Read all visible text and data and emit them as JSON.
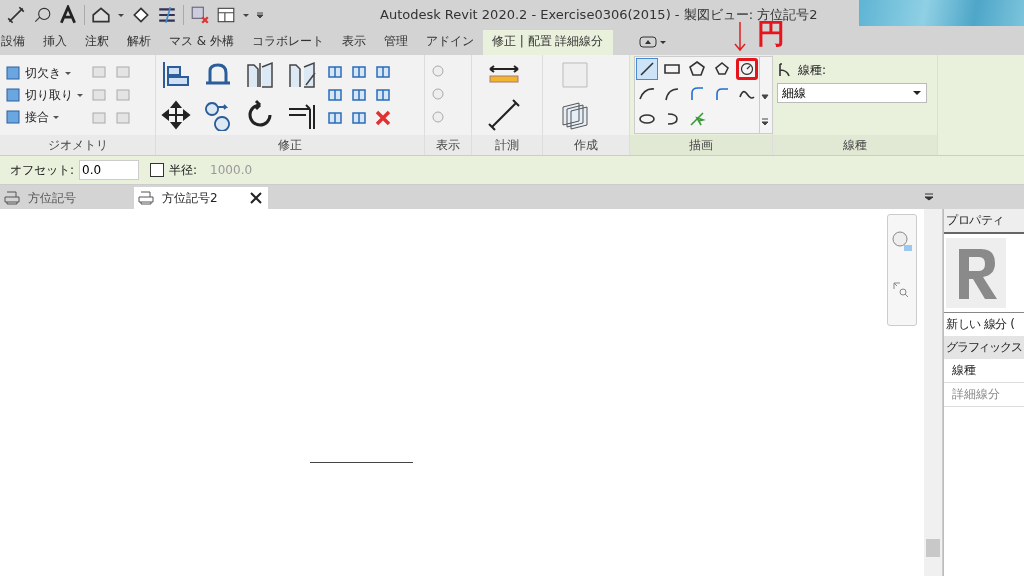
{
  "title_bar": {
    "title": "Autodesk Revit 2020.2 - Exercise0306(2015) - 製図ビュー: 方位記号2"
  },
  "ribbon_tabs": [
    {
      "label": "設備",
      "selected": false
    },
    {
      "label": "挿入",
      "selected": false
    },
    {
      "label": "注釈",
      "selected": false
    },
    {
      "label": "解析",
      "selected": false
    },
    {
      "label": "マス & 外構",
      "selected": false
    },
    {
      "label": "コラボレート",
      "selected": false
    },
    {
      "label": "表示",
      "selected": false
    },
    {
      "label": "管理",
      "selected": false
    },
    {
      "label": "アドイン",
      "selected": false
    },
    {
      "label": "修正 | 配置 詳細線分",
      "selected": true
    }
  ],
  "ribbon_panels": [
    {
      "kind": "geometry",
      "label": "ジオメトリ",
      "commands": [
        {
          "label": "切欠き"
        },
        {
          "label": "切り取り"
        },
        {
          "label": "接合"
        }
      ]
    },
    {
      "kind": "modify",
      "label": "修正"
    },
    {
      "kind": "view",
      "label": "表示"
    },
    {
      "kind": "measure",
      "label": "計測"
    },
    {
      "kind": "create",
      "label": "作成"
    },
    {
      "kind": "draw",
      "label": "描画",
      "tools": [
        {
          "kind": "line",
          "selected": true
        },
        {
          "kind": "rect",
          "selected": false
        },
        {
          "kind": "polygon",
          "selected": false
        },
        {
          "kind": "polygon2",
          "selected": false
        },
        {
          "kind": "circle",
          "selected": false,
          "annotated": true
        },
        {
          "kind": "arc3",
          "selected": false
        },
        {
          "kind": "arc",
          "selected": false
        },
        {
          "kind": "arc-tan",
          "selected": false
        },
        {
          "kind": "fillet",
          "selected": false
        },
        {
          "kind": "spline",
          "selected": false
        },
        {
          "kind": "ellipse",
          "selected": false
        },
        {
          "kind": "half",
          "selected": false
        },
        {
          "kind": "pick",
          "selected": false
        }
      ]
    },
    {
      "kind": "linestyle",
      "label": "線種",
      "field_label": "線種:",
      "value": "細線"
    }
  ],
  "annotation": {
    "label": "円"
  },
  "options_bar": {
    "offset_label": "オフセット:",
    "offset_value": "0.0",
    "radius_checked": false,
    "radius_label": "半径:",
    "radius_value": "1000.0"
  },
  "view_tabs": [
    {
      "label": "方位記号",
      "selected": false
    },
    {
      "label": "方位記号2",
      "selected": true
    }
  ],
  "properties": {
    "title": "プロパティ",
    "type_name": "新しい 線分 (",
    "section": "グラフィックス",
    "rows": [
      {
        "label": "線種",
        "disabled": false
      },
      {
        "label": "詳細線分",
        "disabled": true
      }
    ]
  }
}
